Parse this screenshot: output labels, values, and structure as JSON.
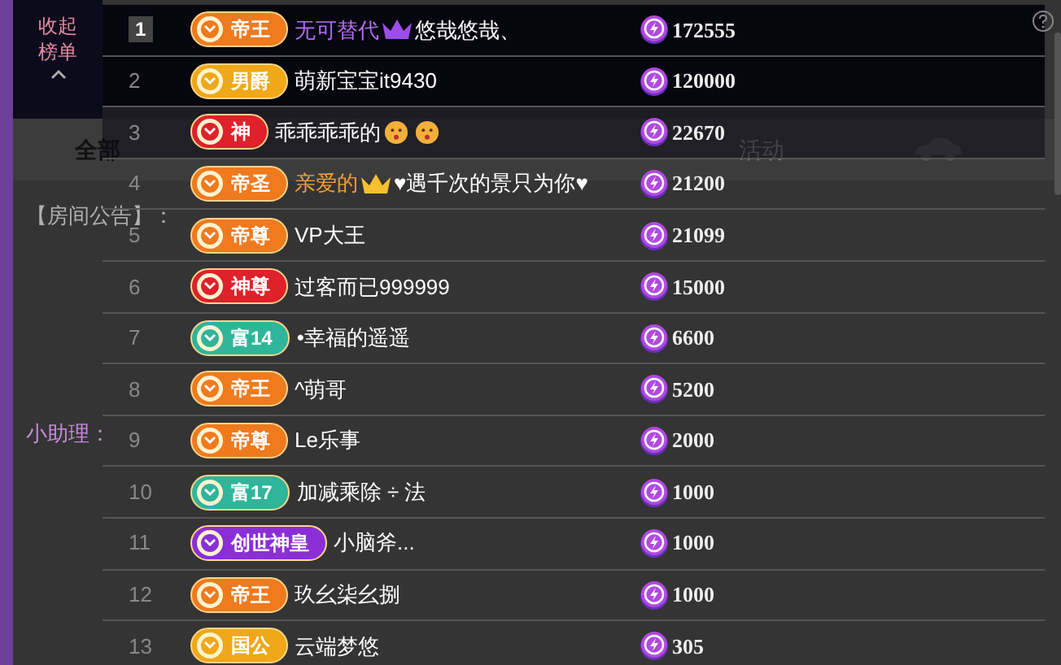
{
  "background": {
    "tabs": [
      {
        "label": "全部",
        "selected": true
      },
      {
        "label": "活动",
        "selected": false
      }
    ],
    "notice": "【房间公告】：",
    "assistant": "小助理："
  },
  "panel": {
    "collapse": "收起榜单",
    "rows": [
      {
        "rank": "1",
        "boxed": true,
        "badge": {
          "label": "帝王",
          "color": "#f07a1e"
        },
        "name": [
          {
            "kind": "text",
            "text": "无可替代",
            "color": "#b46cf5"
          },
          {
            "kind": "crown",
            "color": "#9b4de8"
          },
          {
            "kind": "text",
            "text": "悠哉悠哉、",
            "color": "#ffffff"
          }
        ],
        "value": "172555"
      },
      {
        "rank": "2",
        "boxed": false,
        "badge": {
          "label": "男爵",
          "color": "#f0a818"
        },
        "name": [
          {
            "kind": "text",
            "text": "萌新宝宝it9430",
            "color": "#ffffff"
          }
        ],
        "value": "120000"
      },
      {
        "rank": "3",
        "boxed": false,
        "badge": {
          "label": "神",
          "color": "#e0202a"
        },
        "name": [
          {
            "kind": "text",
            "text": "乖乖乖乖的",
            "color": "#ffffff"
          },
          {
            "kind": "emoji",
            "color": "#f2b03a"
          },
          {
            "kind": "emoji",
            "color": "#f2b03a"
          }
        ],
        "value": "22670"
      },
      {
        "rank": "4",
        "boxed": false,
        "badge": {
          "label": "帝圣",
          "color": "#f07a1e"
        },
        "name": [
          {
            "kind": "text",
            "text": "亲爱的",
            "color": "#f0a040"
          },
          {
            "kind": "crown",
            "color": "#f5c030"
          },
          {
            "kind": "text",
            "text": "♥遇千次的景只为你♥",
            "color": "#ffffff"
          }
        ],
        "value": "21200"
      },
      {
        "rank": "5",
        "boxed": false,
        "badge": {
          "label": "帝尊",
          "color": "#f07a1e"
        },
        "name": [
          {
            "kind": "text",
            "text": "VP大王",
            "color": "#ffffff"
          }
        ],
        "value": "21099"
      },
      {
        "rank": "6",
        "boxed": false,
        "badge": {
          "label": "神尊",
          "color": "#e0202a"
        },
        "name": [
          {
            "kind": "text",
            "text": "过客而已999999",
            "color": "#ffffff"
          }
        ],
        "value": "15000"
      },
      {
        "rank": "7",
        "boxed": false,
        "badge": {
          "label": "富14",
          "color": "#2fb59a"
        },
        "name": [
          {
            "kind": "text",
            "text": "•幸福的遥遥",
            "color": "#ffffff"
          }
        ],
        "value": "6600"
      },
      {
        "rank": "8",
        "boxed": false,
        "badge": {
          "label": "帝王",
          "color": "#f07a1e"
        },
        "name": [
          {
            "kind": "text",
            "text": "^萌哥",
            "color": "#ffffff"
          }
        ],
        "value": "5200"
      },
      {
        "rank": "9",
        "boxed": false,
        "badge": {
          "label": "帝尊",
          "color": "#f07a1e"
        },
        "name": [
          {
            "kind": "text",
            "text": "Le乐事",
            "color": "#ffffff"
          }
        ],
        "value": "2000"
      },
      {
        "rank": "10",
        "boxed": false,
        "badge": {
          "label": "富17",
          "color": "#2fb59a"
        },
        "name": [
          {
            "kind": "text",
            "text": "加减乘除 ÷ 法",
            "color": "#ffffff"
          }
        ],
        "value": "1000"
      },
      {
        "rank": "11",
        "boxed": false,
        "badge": {
          "label": "创世神皇",
          "color": "#8a2fd8"
        },
        "name": [
          {
            "kind": "text",
            "text": "小脑斧...",
            "color": "#ffffff"
          }
        ],
        "value": "1000"
      },
      {
        "rank": "12",
        "boxed": false,
        "badge": {
          "label": "帝王",
          "color": "#f07a1e"
        },
        "name": [
          {
            "kind": "text",
            "text": "玖幺柒幺捌",
            "color": "#ffffff"
          }
        ],
        "value": "1000"
      },
      {
        "rank": "13",
        "boxed": false,
        "badge": {
          "label": "国公",
          "color": "#f0a818"
        },
        "name": [
          {
            "kind": "text",
            "text": "云端梦悠",
            "color": "#ffffff"
          }
        ],
        "value": "305"
      }
    ]
  }
}
